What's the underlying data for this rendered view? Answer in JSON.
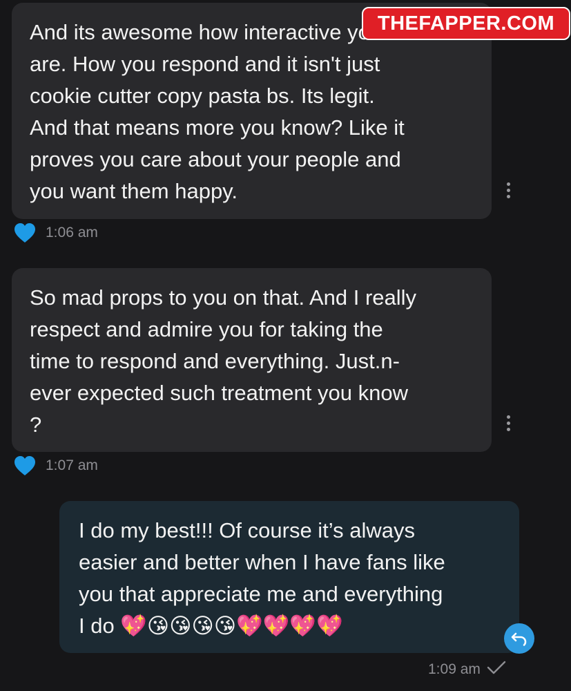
{
  "watermark": {
    "text": "THEFAPPER.COM"
  },
  "messages": [
    {
      "text": "And its awesome how interactive you\nare. How you respond and it isn't just\ncookie cutter copy pasta bs. Its legit.\nAnd that means more you know? Like it\nproves you care about your people and\nyou want them happy.",
      "time": "1:06 am",
      "liked": true
    },
    {
      "text": "So mad props to you on that. And I really\nrespect and admire you for taking the\ntime to respond and everything. Just.n-\never expected such treatment you know\n?",
      "time": "1:07 am",
      "liked": true
    },
    {
      "text": "I do my best!!! Of course it’s always\neasier and better when I have fans like\nyou that appreciate me and everything\nI do 💖😘😘😘😘💖💖💖💖",
      "time": "1:09 am",
      "outgoing": true
    }
  ],
  "colors": {
    "accent": "#2f9be0",
    "heart": "#1e9be6",
    "incoming_bubble": "#29292c",
    "outgoing_bubble": "#1c2a33"
  }
}
